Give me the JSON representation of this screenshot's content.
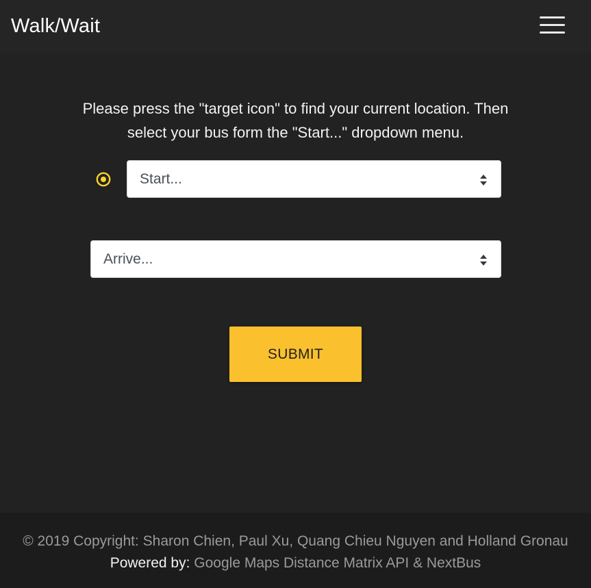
{
  "navbar": {
    "brand": "Walk/Wait",
    "menu_icon": "hamburger-menu-icon"
  },
  "main": {
    "instructions": "Please press the \"target icon\" to find your current location. Then select your bus form the \"Start...\" dropdown menu.",
    "target_icon": "target-icon",
    "start_select": {
      "value": "Start..."
    },
    "arrive_select": {
      "value": "Arrive..."
    },
    "submit_label": "SUBMIT"
  },
  "footer": {
    "copyright": "© 2019 Copyright: Sharon Chien, Paul Xu, Quang Chieu Nguyen and Holland Gronau",
    "powered_label": "Powered by:",
    "powered_link": "Google Maps Distance Matrix API & NextBus"
  },
  "colors": {
    "background": "#222222",
    "navbar": "#252525",
    "footer": "#1c1c1c",
    "accent": "#fbc02d",
    "target_icon": "#fbd32a"
  }
}
